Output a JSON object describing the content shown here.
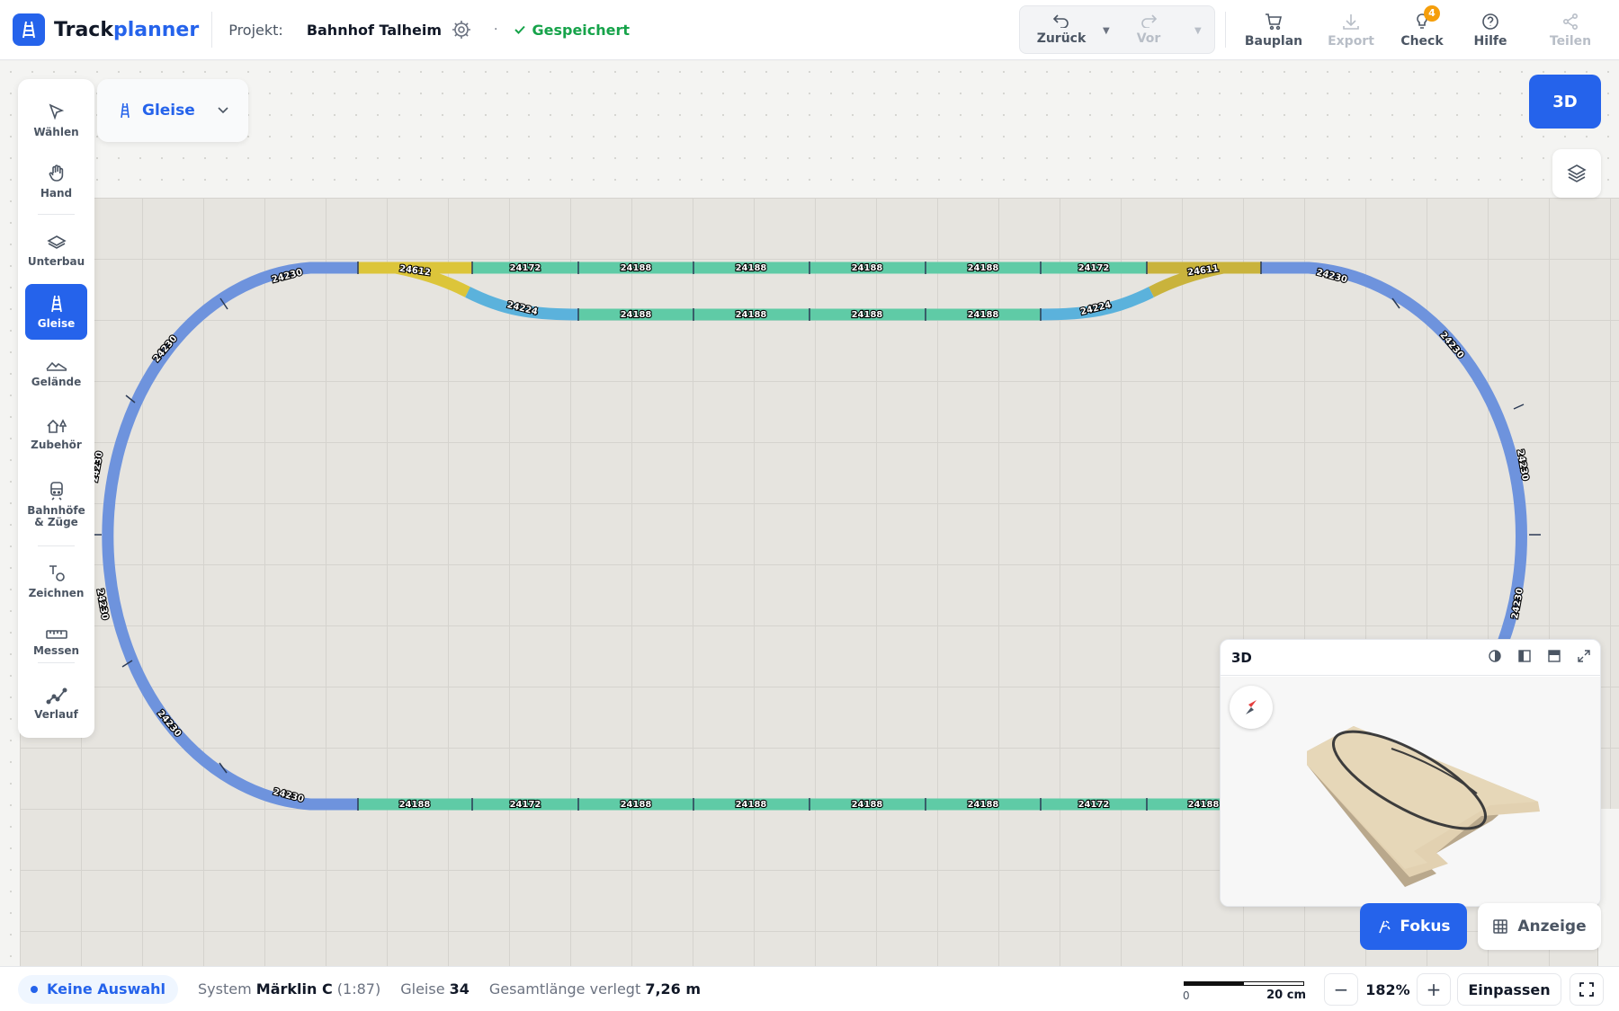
{
  "app": {
    "name_part1": "Track",
    "name_part2": "planner",
    "accent_color": "#2563eb"
  },
  "header": {
    "project_label": "Projekt:",
    "project_name": "Bahnhof Talheim",
    "separator": "·",
    "saved_status": "Gespeichert",
    "undo_label": "Zurück",
    "redo_label": "Vor",
    "bauplan_label": "Bauplan",
    "export_label": "Export",
    "check_label": "Check",
    "check_badge": "4",
    "help_label": "Hilfe",
    "share_label": "Teilen"
  },
  "toolbar": {
    "items": [
      {
        "label": "Wählen",
        "icon": "cursor-arrow-icon"
      },
      {
        "label": "Hand",
        "icon": "hand-icon"
      },
      {
        "label": "Unterbau",
        "icon": "layers-base-icon"
      },
      {
        "label": "Gleise",
        "icon": "track-icon",
        "active": true
      },
      {
        "label": "Gelände",
        "icon": "terrain-icon"
      },
      {
        "label": "Zubehör",
        "icon": "house-tree-icon"
      },
      {
        "label": "Bahnhöfe & Züge",
        "icon": "train-icon"
      },
      {
        "label": "Zeichnen",
        "icon": "shapes-icon"
      },
      {
        "label": "Messen",
        "icon": "ruler-icon"
      },
      {
        "label": "Verlauf",
        "icon": "history-graph-icon"
      }
    ]
  },
  "layer_select": {
    "value": "Gleise"
  },
  "view_toggle": {
    "label_3d": "3D"
  },
  "track_labels": {
    "top_main": [
      "24612",
      "24172",
      "24188",
      "24188",
      "24188",
      "24188",
      "24172",
      "24611"
    ],
    "siding": [
      "24224",
      "24188",
      "24188",
      "24188",
      "24188",
      "24224"
    ],
    "bottom_main": [
      "24188",
      "24172",
      "24188",
      "24188",
      "24188",
      "24188",
      "24172",
      "24188"
    ],
    "left_curve": [
      "24230",
      "24230",
      "24230",
      "24230",
      "24230",
      "24230"
    ],
    "right_curve": [
      "24230",
      "24230",
      "24230",
      "24230"
    ],
    "colors": {
      "curve": "#6e93dd",
      "straight": "#5fcba6",
      "switch": "#dcc53a",
      "siding_curve": "#5bb2dc"
    }
  },
  "preview": {
    "title": "3D"
  },
  "bottom_buttons": {
    "fokus": "Fokus",
    "anzeige": "Anzeige"
  },
  "status": {
    "selection": "Keine Auswahl",
    "system_label": "System",
    "system_value": "Märklin C",
    "system_scale": "(1:87)",
    "tracks_label": "Gleise",
    "tracks_value": "34",
    "length_label": "Gesamtlänge verlegt",
    "length_value": "7,26 m",
    "scale_zero": "0",
    "scale_unit": "20 cm",
    "zoom": "182%",
    "fit": "Einpassen"
  }
}
